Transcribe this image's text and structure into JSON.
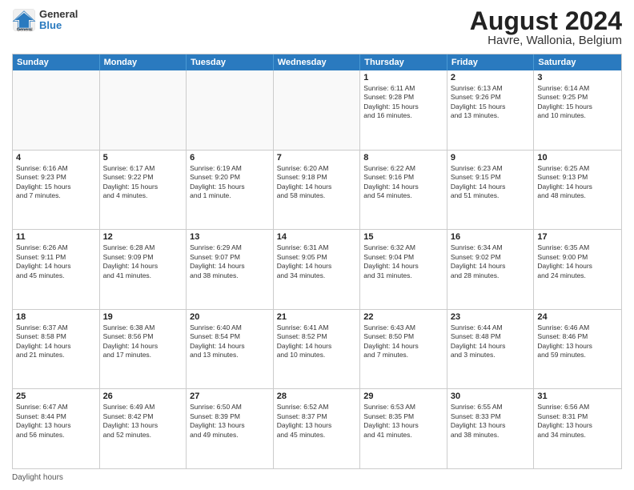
{
  "header": {
    "title": "August 2024",
    "subtitle": "Havre, Wallonia, Belgium",
    "logo_general": "General",
    "logo_blue": "Blue"
  },
  "days_of_week": [
    "Sunday",
    "Monday",
    "Tuesday",
    "Wednesday",
    "Thursday",
    "Friday",
    "Saturday"
  ],
  "footer": {
    "daylight_hours": "Daylight hours"
  },
  "weeks": [
    [
      {
        "day": "",
        "info": ""
      },
      {
        "day": "",
        "info": ""
      },
      {
        "day": "",
        "info": ""
      },
      {
        "day": "",
        "info": ""
      },
      {
        "day": "1",
        "info": "Sunrise: 6:11 AM\nSunset: 9:28 PM\nDaylight: 15 hours\nand 16 minutes."
      },
      {
        "day": "2",
        "info": "Sunrise: 6:13 AM\nSunset: 9:26 PM\nDaylight: 15 hours\nand 13 minutes."
      },
      {
        "day": "3",
        "info": "Sunrise: 6:14 AM\nSunset: 9:25 PM\nDaylight: 15 hours\nand 10 minutes."
      }
    ],
    [
      {
        "day": "4",
        "info": "Sunrise: 6:16 AM\nSunset: 9:23 PM\nDaylight: 15 hours\nand 7 minutes."
      },
      {
        "day": "5",
        "info": "Sunrise: 6:17 AM\nSunset: 9:22 PM\nDaylight: 15 hours\nand 4 minutes."
      },
      {
        "day": "6",
        "info": "Sunrise: 6:19 AM\nSunset: 9:20 PM\nDaylight: 15 hours\nand 1 minute."
      },
      {
        "day": "7",
        "info": "Sunrise: 6:20 AM\nSunset: 9:18 PM\nDaylight: 14 hours\nand 58 minutes."
      },
      {
        "day": "8",
        "info": "Sunrise: 6:22 AM\nSunset: 9:16 PM\nDaylight: 14 hours\nand 54 minutes."
      },
      {
        "day": "9",
        "info": "Sunrise: 6:23 AM\nSunset: 9:15 PM\nDaylight: 14 hours\nand 51 minutes."
      },
      {
        "day": "10",
        "info": "Sunrise: 6:25 AM\nSunset: 9:13 PM\nDaylight: 14 hours\nand 48 minutes."
      }
    ],
    [
      {
        "day": "11",
        "info": "Sunrise: 6:26 AM\nSunset: 9:11 PM\nDaylight: 14 hours\nand 45 minutes."
      },
      {
        "day": "12",
        "info": "Sunrise: 6:28 AM\nSunset: 9:09 PM\nDaylight: 14 hours\nand 41 minutes."
      },
      {
        "day": "13",
        "info": "Sunrise: 6:29 AM\nSunset: 9:07 PM\nDaylight: 14 hours\nand 38 minutes."
      },
      {
        "day": "14",
        "info": "Sunrise: 6:31 AM\nSunset: 9:05 PM\nDaylight: 14 hours\nand 34 minutes."
      },
      {
        "day": "15",
        "info": "Sunrise: 6:32 AM\nSunset: 9:04 PM\nDaylight: 14 hours\nand 31 minutes."
      },
      {
        "day": "16",
        "info": "Sunrise: 6:34 AM\nSunset: 9:02 PM\nDaylight: 14 hours\nand 28 minutes."
      },
      {
        "day": "17",
        "info": "Sunrise: 6:35 AM\nSunset: 9:00 PM\nDaylight: 14 hours\nand 24 minutes."
      }
    ],
    [
      {
        "day": "18",
        "info": "Sunrise: 6:37 AM\nSunset: 8:58 PM\nDaylight: 14 hours\nand 21 minutes."
      },
      {
        "day": "19",
        "info": "Sunrise: 6:38 AM\nSunset: 8:56 PM\nDaylight: 14 hours\nand 17 minutes."
      },
      {
        "day": "20",
        "info": "Sunrise: 6:40 AM\nSunset: 8:54 PM\nDaylight: 14 hours\nand 13 minutes."
      },
      {
        "day": "21",
        "info": "Sunrise: 6:41 AM\nSunset: 8:52 PM\nDaylight: 14 hours\nand 10 minutes."
      },
      {
        "day": "22",
        "info": "Sunrise: 6:43 AM\nSunset: 8:50 PM\nDaylight: 14 hours\nand 7 minutes."
      },
      {
        "day": "23",
        "info": "Sunrise: 6:44 AM\nSunset: 8:48 PM\nDaylight: 14 hours\nand 3 minutes."
      },
      {
        "day": "24",
        "info": "Sunrise: 6:46 AM\nSunset: 8:46 PM\nDaylight: 13 hours\nand 59 minutes."
      }
    ],
    [
      {
        "day": "25",
        "info": "Sunrise: 6:47 AM\nSunset: 8:44 PM\nDaylight: 13 hours\nand 56 minutes."
      },
      {
        "day": "26",
        "info": "Sunrise: 6:49 AM\nSunset: 8:42 PM\nDaylight: 13 hours\nand 52 minutes."
      },
      {
        "day": "27",
        "info": "Sunrise: 6:50 AM\nSunset: 8:39 PM\nDaylight: 13 hours\nand 49 minutes."
      },
      {
        "day": "28",
        "info": "Sunrise: 6:52 AM\nSunset: 8:37 PM\nDaylight: 13 hours\nand 45 minutes."
      },
      {
        "day": "29",
        "info": "Sunrise: 6:53 AM\nSunset: 8:35 PM\nDaylight: 13 hours\nand 41 minutes."
      },
      {
        "day": "30",
        "info": "Sunrise: 6:55 AM\nSunset: 8:33 PM\nDaylight: 13 hours\nand 38 minutes."
      },
      {
        "day": "31",
        "info": "Sunrise: 6:56 AM\nSunset: 8:31 PM\nDaylight: 13 hours\nand 34 minutes."
      }
    ]
  ]
}
